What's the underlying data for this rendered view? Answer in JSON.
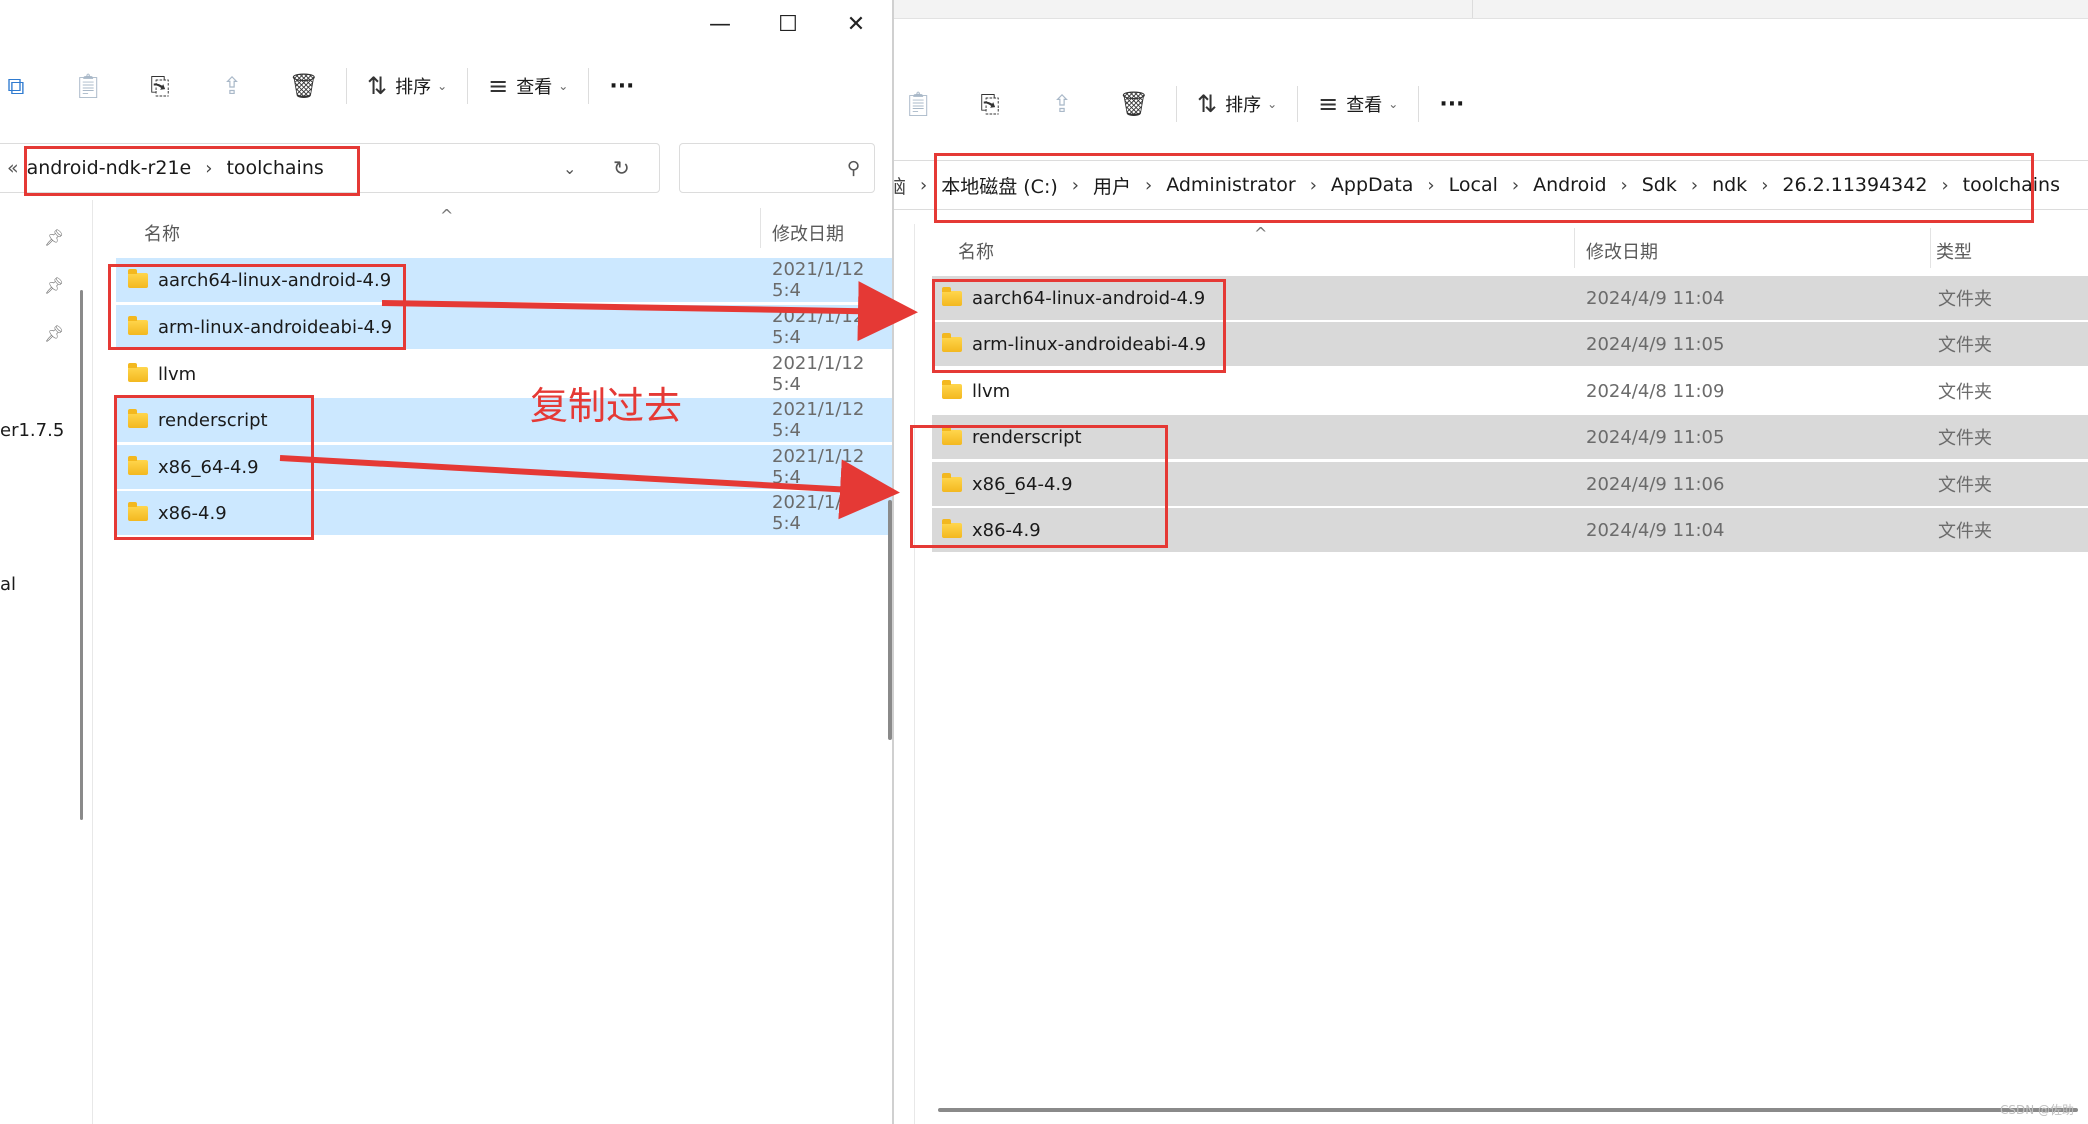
{
  "left_window": {
    "caption": {
      "minimize": "—",
      "maximize": "☐",
      "close": "✕"
    },
    "toolbar": {
      "sort_label": "排序",
      "view_label": "查看",
      "more_label": "···"
    },
    "address": {
      "back": "«",
      "crumbs": [
        "android-ndk-r21e",
        "toolchains"
      ],
      "sep": "›"
    },
    "search": {
      "placeholder": ""
    },
    "nav_fragments": [
      "er1.7.5",
      "al"
    ],
    "columns": {
      "name": "名称",
      "date": "修改日期"
    },
    "rows": [
      {
        "name": "aarch64-linux-android-4.9",
        "date": "2021/1/12 5:4",
        "selected": true
      },
      {
        "name": "arm-linux-androideabi-4.9",
        "date": "2021/1/12 5:4",
        "selected": true
      },
      {
        "name": "llvm",
        "date": "2021/1/12 5:4",
        "selected": false
      },
      {
        "name": "renderscript",
        "date": "2021/1/12 5:4",
        "selected": true
      },
      {
        "name": "x86_64-4.9",
        "date": "2021/1/12 5:4",
        "selected": true
      },
      {
        "name": "x86-4.9",
        "date": "2021/1/12 5:4",
        "selected": true
      }
    ]
  },
  "right_window": {
    "toolbar": {
      "sort_label": "排序",
      "view_label": "查看",
      "more_label": "···"
    },
    "address": {
      "lead": "脑",
      "crumbs": [
        "本地磁盘 (C:)",
        "用户",
        "Administrator",
        "AppData",
        "Local",
        "Android",
        "Sdk",
        "ndk",
        "26.2.11394342",
        "toolchains"
      ],
      "sep": "›"
    },
    "columns": {
      "name": "名称",
      "date": "修改日期",
      "type": "类型"
    },
    "rows": [
      {
        "name": "aarch64-linux-android-4.9",
        "date": "2024/4/9 11:04",
        "type": "文件夹",
        "selected": true
      },
      {
        "name": "arm-linux-androideabi-4.9",
        "date": "2024/4/9 11:05",
        "type": "文件夹",
        "selected": true
      },
      {
        "name": "llvm",
        "date": "2024/4/8 11:09",
        "type": "文件夹",
        "selected": false
      },
      {
        "name": "renderscript",
        "date": "2024/4/9 11:05",
        "type": "文件夹",
        "selected": true
      },
      {
        "name": "x86_64-4.9",
        "date": "2024/4/9 11:06",
        "type": "文件夹",
        "selected": true
      },
      {
        "name": "x86-4.9",
        "date": "2024/4/9 11:04",
        "type": "文件夹",
        "selected": true
      }
    ]
  },
  "annotation": {
    "text": "复制过去",
    "color": "#e53935"
  },
  "watermark": "CSDN @佐助",
  "colors": {
    "selection_blue": "#cce8ff",
    "selection_gray": "#d9d9d9",
    "annotation_red": "#e53935"
  }
}
